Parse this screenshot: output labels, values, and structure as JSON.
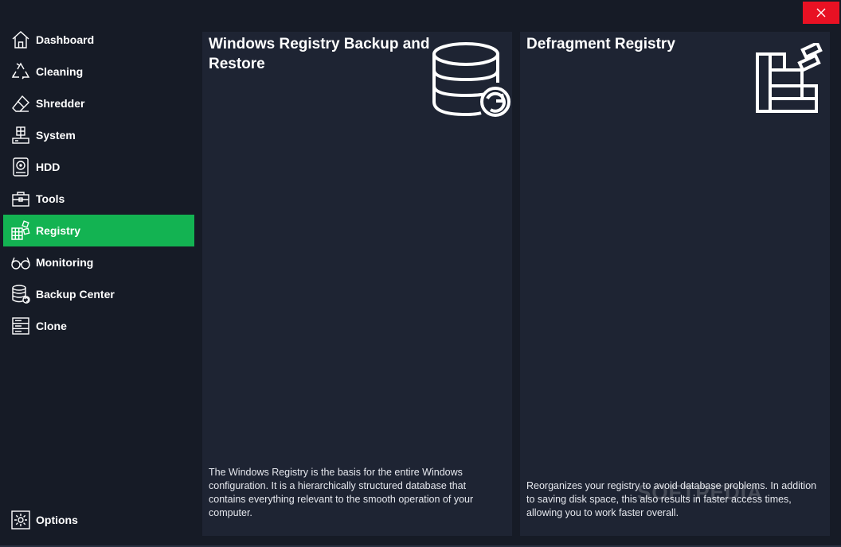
{
  "window": {
    "close_icon": "close-icon",
    "accent_color": "#13b352",
    "close_color": "#e81123",
    "background_color": "#161b26",
    "panel_color": "#1e2433"
  },
  "sidebar": {
    "items": [
      {
        "label": "Dashboard",
        "icon": "home-icon",
        "active": false
      },
      {
        "label": "Cleaning",
        "icon": "recycle-icon",
        "active": false
      },
      {
        "label": "Shredder",
        "icon": "eraser-icon",
        "active": false
      },
      {
        "label": "System",
        "icon": "computer-icon",
        "active": false
      },
      {
        "label": "HDD",
        "icon": "hard-disk-icon",
        "active": false
      },
      {
        "label": "Tools",
        "icon": "toolbox-icon",
        "active": false
      },
      {
        "label": "Registry",
        "icon": "registry-blocks-icon",
        "active": true
      },
      {
        "label": "Monitoring",
        "icon": "glasses-icon",
        "active": false
      },
      {
        "label": "Backup Center",
        "icon": "database-backup-icon",
        "active": false
      },
      {
        "label": "Clone",
        "icon": "clone-drive-icon",
        "active": false
      }
    ],
    "options": {
      "label": "Options",
      "icon": "gear-icon"
    }
  },
  "panels": [
    {
      "title": "Windows Registry Backup and Restore",
      "description": "The Windows Registry is the basis for the entire Windows configuration. It is a hierarchically structured database that contains everything relevant to the smooth operation of your computer.",
      "icon": "database-restore-icon"
    },
    {
      "title": "Defragment Registry",
      "description": "Reorganizes your registry to avoid database problems. In addition to saving disk space, this also results in faster access times, allowing you to work faster overall.",
      "icon": "registry-defragment-icon"
    }
  ],
  "watermark": "SOFTPEDIA"
}
